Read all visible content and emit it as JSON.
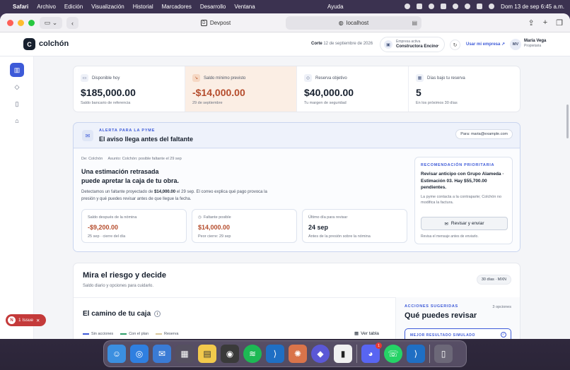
{
  "menubar": {
    "items": [
      "Safari",
      "Archivo",
      "Edición",
      "Visualización",
      "Historial",
      "Marcadores",
      "Desarrollo",
      "Ventana"
    ],
    "help": "Ayuda",
    "datetime": "Dom 13 de sep  6:45 a.m."
  },
  "browser": {
    "tab_title": "Devpost",
    "url": "localhost"
  },
  "app": {
    "brand": "colchón",
    "corte_label": "Corte",
    "corte_date": "12 de septiembre de 2026",
    "company_label": "Empresa activa",
    "company_name": "Constructora Encino",
    "use_company": "Usar mi empresa ↗",
    "avatar": "MV",
    "user_name": "María Vega",
    "user_role": "Propietaria"
  },
  "stats": [
    {
      "label": "Disponible hoy",
      "value": "$185,000.00",
      "sub": "Saldo bancario de referencia",
      "icon": "wallet-icon"
    },
    {
      "label": "Saldo mínimo previsto",
      "value": "-$14,000.00",
      "sub": "29 de septiembre",
      "icon": "trend-down-icon"
    },
    {
      "label": "Reserva objetivo",
      "value": "$40,000.00",
      "sub": "Tu margen de seguridad",
      "icon": "shield-icon"
    },
    {
      "label": "Días bajo tu reserva",
      "value": "5",
      "sub": "En los próximos 30 días",
      "icon": "calendar-icon"
    }
  ],
  "alert": {
    "kicker": "ALERTA PARA LA PYME",
    "title": "El aviso llega antes del faltante",
    "to": "Para: maria@example.com",
    "from": "De: Colchón",
    "subject": "Asunto: Colchón: posible faltante el 29 sep",
    "headline_1": "Una estimación retrasada",
    "headline_2": "puede apretar la caja de tu obra.",
    "para_pre": "Detectamos un faltante proyectado de ",
    "para_amount": "$14,000.00",
    "para_post": " el 29 sep. El correo explica qué pago provoca la presión y qué puedes revisar antes de que llegue la fecha.",
    "minis": [
      {
        "label": "Saldo después de la nómina",
        "value": "-$9,200.00",
        "sub": "25 sep · cierre del día"
      },
      {
        "label": "Faltante posible",
        "value": "$14,000.00",
        "sub": "Peor cierre: 29 sep"
      },
      {
        "label": "Último día para revisar",
        "value": "24 sep",
        "sub": "Antes de la presión sobre la nómina"
      }
    ],
    "reco_kicker": "RECOMENDACIÓN PRIORITARIA",
    "reco_text": "Revisar anticipo con Grupo Alameda · Estimación 03. Hay $55,700.00 pendientes.",
    "reco_note": "La pyme contacta a la contraparte; Colchón no modifica la factura.",
    "reco_button": "Revisar y enviar",
    "reco_foot": "Revisa el mensaje antes de enviarlo."
  },
  "risk": {
    "title": "Mira el riesgo y decide",
    "sub": "Saldo diario y opciones para cuidarlo.",
    "pill": "30 días · MXN",
    "path_title": "El camino de tu caja",
    "legend": [
      "Sin acciones",
      "Con el plan",
      "Reserva"
    ],
    "legend_colors": [
      "#3d5ad8",
      "#2e9e6a",
      "#d9c79a"
    ],
    "table_button": "Ver tabla",
    "actions_kicker": "ACCIONES SUGERIDAS",
    "actions_count": "3 opciones",
    "actions_title": "Qué puedes revisar",
    "best_label": "MEJOR RESULTADO SIMULADO"
  },
  "issue": {
    "badge": "N",
    "label": "1 Issue"
  },
  "dock": {
    "apps": [
      "finder-icon",
      "safari-icon",
      "mail-icon",
      "launchpad-icon",
      "notes-icon",
      "chrome-icon",
      "spotify-icon",
      "vscode-icon",
      "claude-icon",
      "proton-icon",
      "terminal-icon",
      "discord-icon",
      "whatsapp-icon",
      "vscode-alt-icon",
      "trash-icon"
    ],
    "discord_badge": "1"
  }
}
